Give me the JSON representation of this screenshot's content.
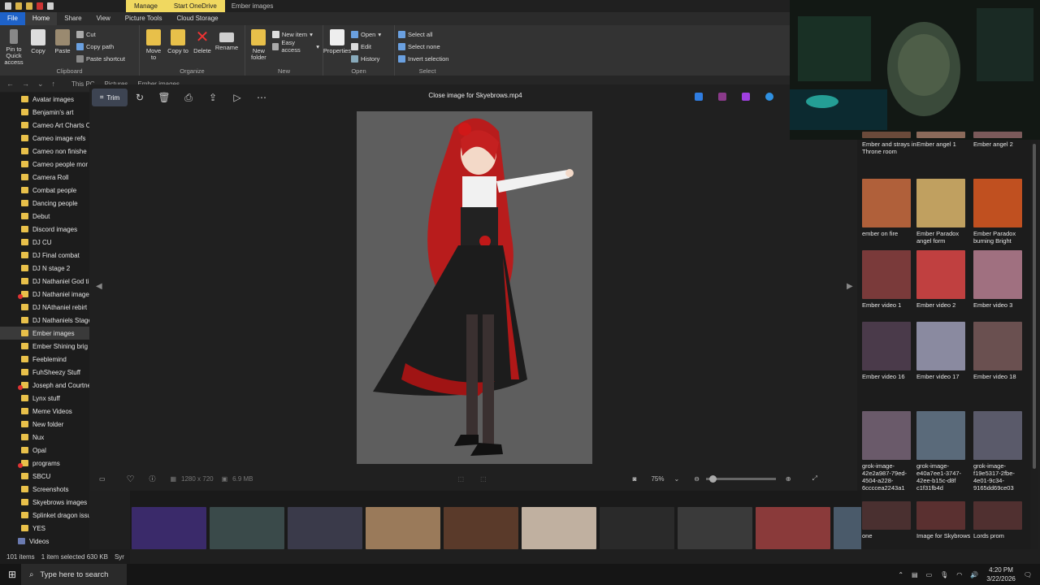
{
  "titlebar": {
    "context_tabs": [
      "Manage",
      "Start OneDrive"
    ],
    "window_title": "Ember images"
  },
  "ribbon": {
    "tabs": [
      "File",
      "Home",
      "Share",
      "View",
      "Picture Tools",
      "Cloud Storage"
    ],
    "clipboard": {
      "pin": "Pin to Quick access",
      "copy": "Copy",
      "paste": "Paste",
      "cut": "Cut",
      "copy_path": "Copy path",
      "paste_shortcut": "Paste shortcut",
      "label": "Clipboard"
    },
    "organize": {
      "move_to": "Move to",
      "copy_to": "Copy to",
      "delete": "Delete",
      "rename": "Rename",
      "label": "Organize"
    },
    "new": {
      "new_folder": "New folder",
      "new_item": "New item",
      "easy_access": "Easy access",
      "label": "New"
    },
    "open": {
      "properties": "Properties",
      "open": "Open",
      "edit": "Edit",
      "history": "History",
      "label": "Open"
    },
    "select": {
      "select_all": "Select all",
      "select_none": "Select none",
      "invert": "Invert selection",
      "label": "Select"
    }
  },
  "address": {
    "crumbs": [
      "This PC",
      "Pictures",
      "Ember images"
    ]
  },
  "nav": {
    "items": [
      {
        "label": "Avatar images"
      },
      {
        "label": "Benjamin's art"
      },
      {
        "label": "Cameo Art Charts C"
      },
      {
        "label": "Cameo image refs"
      },
      {
        "label": "Cameo non finishe"
      },
      {
        "label": "Cameo people mor"
      },
      {
        "label": "Camera Roll"
      },
      {
        "label": "Combat people"
      },
      {
        "label": "Dancing people"
      },
      {
        "label": "Debut"
      },
      {
        "label": "Discord images"
      },
      {
        "label": "DJ CU"
      },
      {
        "label": "DJ Final combat"
      },
      {
        "label": "DJ N stage 2"
      },
      {
        "label": "DJ Nathaniel God ti"
      },
      {
        "label": "DJ Nathaniel image"
      },
      {
        "label": "DJ NAthaniel rebirt"
      },
      {
        "label": "DJ Nathaniels Stage"
      },
      {
        "label": "Ember images"
      },
      {
        "label": "Ember Shining brig"
      },
      {
        "label": "Feeblemind"
      },
      {
        "label": "FuhSheezy Stuff"
      },
      {
        "label": "Joseph and Courtne"
      },
      {
        "label": "Lynx stuff"
      },
      {
        "label": "Meme Videos"
      },
      {
        "label": "New folder"
      },
      {
        "label": "Nux"
      },
      {
        "label": "Opal"
      },
      {
        "label": "programs"
      },
      {
        "label": "SBCU"
      },
      {
        "label": "Screenshots"
      },
      {
        "label": "Skyebrows images"
      },
      {
        "label": "Splinket dragon issue"
      },
      {
        "label": "YES"
      },
      {
        "label": "Videos"
      }
    ]
  },
  "viewer": {
    "trim": "Trim",
    "title": "Close image for Skyebrows.mp4",
    "dimensions": "1280 x 720",
    "size": "6.9 MB",
    "zoom": "75%"
  },
  "right_tiles": [
    {
      "label": "Ember and strays in Throne room",
      "color": "#6a4a3a"
    },
    {
      "label": "Ember angel 1",
      "color": "#8a6a5a"
    },
    {
      "label": "Ember angel 2",
      "color": "#7a5a5a"
    },
    {
      "label": "ember on fire",
      "color": "#b0603a"
    },
    {
      "label": "Ember Paradox angel form",
      "color": "#c0a060"
    },
    {
      "label": "Ember Paradox burning Bright",
      "color": "#c05020"
    },
    {
      "label": "Ember video 1",
      "color": "#7a3a3a"
    },
    {
      "label": "Ember video 2",
      "color": "#c04040"
    },
    {
      "label": "Ember video 3",
      "color": "#a07080"
    },
    {
      "label": "Ember video 16",
      "color": "#4a3a4a"
    },
    {
      "label": "Ember video 17",
      "color": "#8a8aa0"
    },
    {
      "label": "Ember video 18",
      "color": "#6a5050"
    },
    {
      "label": "grok-image-42e2a987-79ed-4504-a228-6ccccea2243a1",
      "color": "#6a5a6a"
    },
    {
      "label": "grok-image-e40a7ee1-3747-42ee-b15c-d8f c1f31fb4d",
      "color": "#5a6a7a"
    },
    {
      "label": "grok-image-f19e5317-2fbe-4e01-9c34-9165dd69ce03",
      "color": "#5a5a6a"
    },
    {
      "label": "one",
      "color": "#4a3030"
    },
    {
      "label": "Image for Skybrows",
      "color": "#5a3030"
    },
    {
      "label": "Lords prom",
      "color": "#503030"
    }
  ],
  "filmstrip": [
    "#3a2a6a",
    "#3a4a4a",
    "#3a3a4a",
    "#9a7a5a",
    "#5a3a2a",
    "#c0b0a0",
    "#2a2a2a",
    "#3a3a3a",
    "#8a3a3a",
    "#4a5a6a"
  ],
  "status": {
    "count": "101 items",
    "selected": "1 item selected 630 KB",
    "sync": "Syr"
  },
  "taskbar": {
    "search": "Type here to search",
    "time": "4:20 PM",
    "date": "3/22/2026"
  }
}
